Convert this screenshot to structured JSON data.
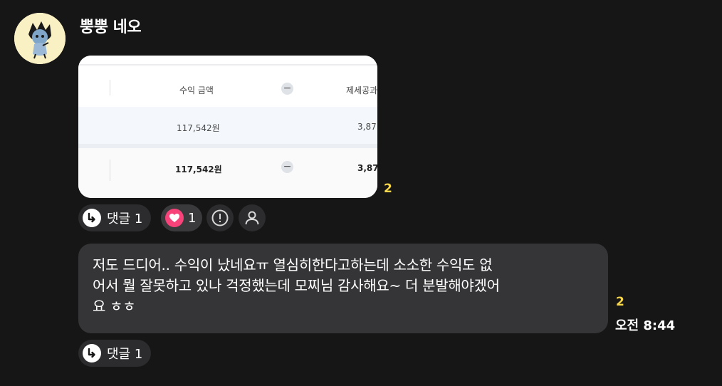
{
  "sender": {
    "name": "뿡뿡 네오"
  },
  "image_message": {
    "table": {
      "header": [
        "수익 금액",
        "제세공과"
      ],
      "row1": [
        "117,542원",
        "3,87"
      ],
      "row2": [
        "117,542원",
        "3,87"
      ]
    },
    "unread_count": "2"
  },
  "image_reactions": {
    "comments_label": "댓글 1",
    "likes_count": "1"
  },
  "text_message": {
    "line1": "저도 드디어.. 수익이 났네요ㅠ 열심히한다고하는데 소소한 수익도 없",
    "line2": "어서 뭘 잘못하고 있나 걱정했는데 모찌님 감사해요~ 더 분발해야겠어",
    "line3": "요 ㅎㅎ",
    "unread_count": "2",
    "time": "오전 8:44"
  },
  "text_reactions": {
    "comments_label": "댓글 1"
  },
  "icons": {
    "avatar": "neo-character-avatar",
    "reply": "reply-arrow-icon",
    "heart": "heart-icon",
    "report": "exclamation-circle-icon",
    "profile": "person-icon"
  },
  "colors": {
    "background": "#161616",
    "bubble": "#353537",
    "unread": "#f8d84a",
    "heart": "#f7427a"
  }
}
